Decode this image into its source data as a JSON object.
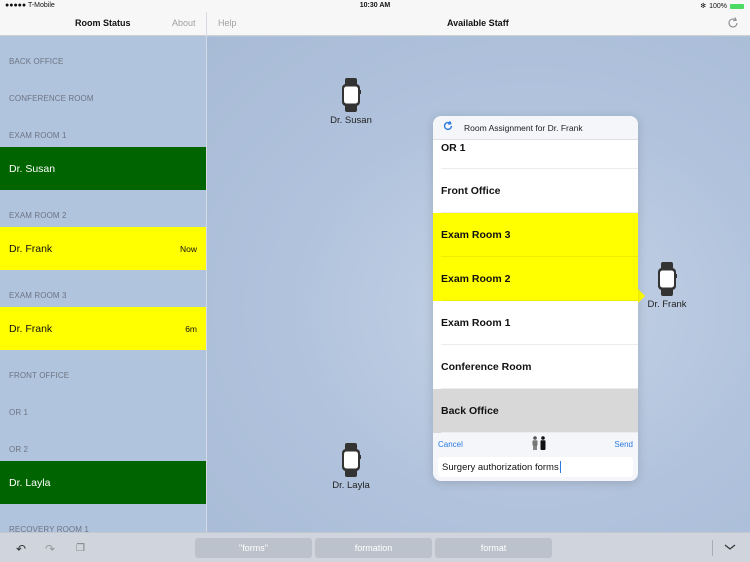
{
  "status_bar": {
    "carrier": "●●●●● T-Mobile",
    "wifi_icon": "wifi-icon",
    "time": "10:30 AM",
    "bluetooth_icon": "bluetooth-icon",
    "battery": "100%"
  },
  "left_nav": {
    "title": "Room Status",
    "about": "About"
  },
  "right_nav": {
    "help": "Help",
    "title": "Available Staff",
    "refresh_icon": "refresh-icon"
  },
  "sidebar": {
    "sections": [
      {
        "header": "BACK OFFICE",
        "staff": []
      },
      {
        "header": "CONFERENCE ROOM",
        "staff": []
      },
      {
        "header": "EXAM ROOM 1",
        "staff": [
          {
            "name": "Dr. Susan",
            "time": "",
            "color": "#006400"
          }
        ]
      },
      {
        "header": "EXAM ROOM 2",
        "staff": [
          {
            "name": "Dr. Frank",
            "time": "Now",
            "color": "#ffff00"
          }
        ]
      },
      {
        "header": "EXAM ROOM 3",
        "staff": [
          {
            "name": "Dr. Frank",
            "time": "6m",
            "color": "#ffff00"
          }
        ]
      },
      {
        "header": "FRONT OFFICE",
        "staff": []
      },
      {
        "header": "OR 1",
        "staff": []
      },
      {
        "header": "OR 2",
        "staff": [
          {
            "name": "Dr. Layla",
            "time": "",
            "color": "#006400"
          }
        ]
      },
      {
        "header": "RECOVERY ROOM 1",
        "staff": []
      }
    ]
  },
  "available_staff": [
    {
      "name": "Dr. Susan",
      "icon": "watch-icon"
    },
    {
      "name": "Dr. Frank",
      "icon": "watch-icon"
    },
    {
      "name": "Dr. Layla",
      "icon": "watch-icon"
    }
  ],
  "popover": {
    "title": "Room Assignment for Dr. Frank",
    "rooms": [
      {
        "label": "OR 1",
        "state": "normal"
      },
      {
        "label": "Front Office",
        "state": "normal"
      },
      {
        "label": "Exam Room 3",
        "state": "assigned"
      },
      {
        "label": "Exam Room 2",
        "state": "assigned"
      },
      {
        "label": "Exam Room 1",
        "state": "normal"
      },
      {
        "label": "Conference Room",
        "state": "normal"
      },
      {
        "label": "Back Office",
        "state": "selected"
      }
    ],
    "cancel": "Cancel",
    "send": "Send",
    "message_value": "Surgery authorization forms"
  },
  "keyboard_bar": {
    "suggestions": [
      "\"forms\"",
      "formation",
      "format"
    ]
  },
  "colors": {
    "assigned": "#ffff00",
    "available": "#006400",
    "accent": "#2a7ae2"
  }
}
